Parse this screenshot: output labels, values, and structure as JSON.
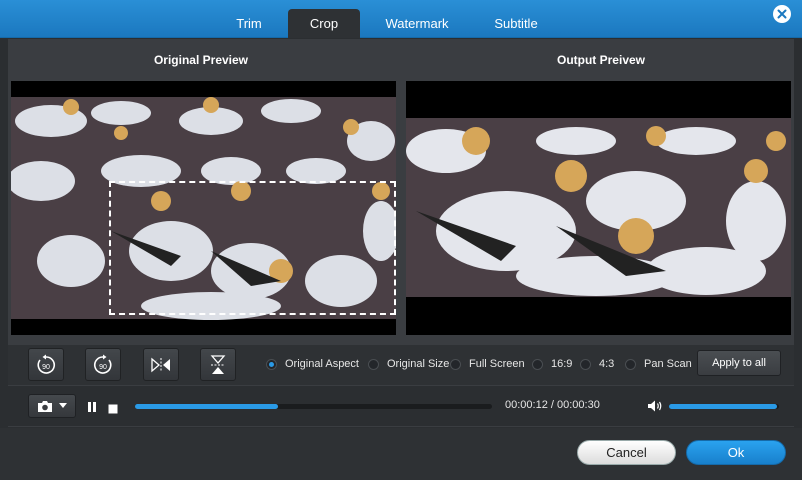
{
  "tabs": [
    {
      "label": "Trim",
      "active": false
    },
    {
      "label": "Crop",
      "active": true
    },
    {
      "label": "Watermark",
      "active": false
    },
    {
      "label": "Subtitle",
      "active": false
    }
  ],
  "close_icon": "close-icon",
  "previews": {
    "original_label": "Original Preview",
    "output_label": "Output Preivew"
  },
  "tools": {
    "rotate_left_icon": "rotate-left-90-icon",
    "rotate_right_icon": "rotate-right-90-icon",
    "flip_horizontal_icon": "flip-horizontal-icon",
    "flip_vertical_icon": "flip-vertical-icon",
    "rotate_left_text": "90",
    "rotate_right_text": "90"
  },
  "aspect_options": [
    {
      "label": "Original Aspect",
      "selected": true
    },
    {
      "label": "Original Size",
      "selected": false
    },
    {
      "label": "Full Screen",
      "selected": false
    },
    {
      "label": "16:9",
      "selected": false
    },
    {
      "label": "4:3",
      "selected": false
    },
    {
      "label": "Pan Scan",
      "selected": false
    }
  ],
  "apply_label": "Apply to all",
  "player": {
    "snapshot_icon": "camera-icon",
    "pause_icon": "pause-icon",
    "stop_icon": "stop-icon",
    "volume_icon": "volume-icon",
    "time": "00:00:12 / 00:00:30",
    "progress_fraction": 0.4,
    "volume_fraction": 0.98
  },
  "footer": {
    "cancel_label": "Cancel",
    "ok_label": "Ok"
  },
  "colors": {
    "accent": "#2a9ae6",
    "titlebar": "#1f82c9",
    "panel": "#3a3d41"
  }
}
